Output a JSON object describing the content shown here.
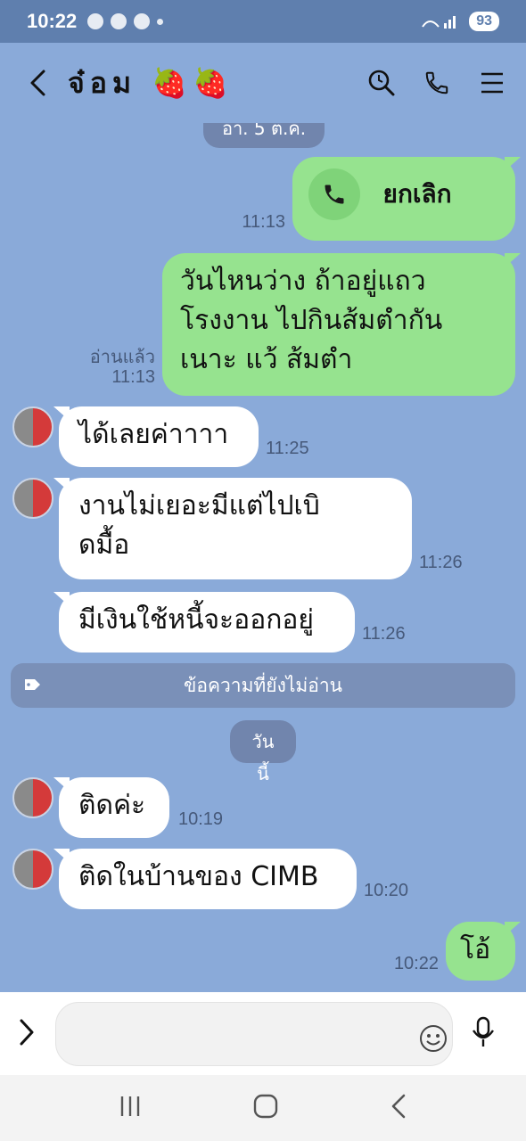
{
  "status_bar": {
    "time": "10:22",
    "battery": "93"
  },
  "header": {
    "title": "จ๋อม 🍓🍓"
  },
  "chat": {
    "partial_date": "อา. 5 ต.ค.",
    "call": {
      "label": "ยกเลิก",
      "time": "11:13"
    },
    "msg1": {
      "lines": [
        "วันไหนว่าง ถ้าอยู่แถว",
        "โรงงาน ไปกินส้มตำกัน",
        "เนาะ แว้ ส้มตำ"
      ],
      "read_label": "อ่านแล้ว",
      "time": "11:13"
    },
    "in1": {
      "text": "ได้เลยค่าาาา",
      "time": "11:25"
    },
    "in2": {
      "lines": [
        "งานไม่เยอะมีแต่ไปเบิ",
        "ดมื้อ"
      ],
      "time": "11:26"
    },
    "in3": {
      "text": "มีเงินใช้หนี้จะออกอยู่",
      "time": "11:26"
    },
    "unread_label": "ข้อความที่ยังไม่อ่าน",
    "today_label": "วันนี้",
    "in4": {
      "text": "ติดค่ะ",
      "time": "10:19"
    },
    "in5": {
      "text": "ติดในบ้านของ CIMB",
      "time": "10:20"
    },
    "out2": {
      "text": "โอ้",
      "time": "10:22"
    }
  },
  "input": {
    "placeholder": ""
  },
  "colors": {
    "chat_bg": "#8aaad9",
    "outgoing_bubble": "#96e38f",
    "incoming_bubble": "#ffffff"
  },
  "icons": [
    "back-icon",
    "search-icon",
    "phone-icon",
    "menu-icon",
    "expand-icon",
    "emoji-icon",
    "mic-icon",
    "recents-icon",
    "home-icon",
    "nav-back-icon"
  ]
}
